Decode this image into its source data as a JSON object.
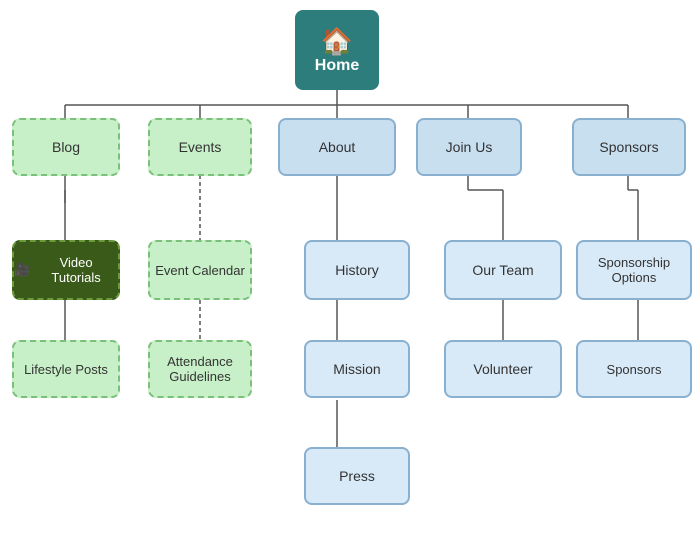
{
  "nodes": {
    "home": {
      "label": "Home",
      "icon": "🏠"
    },
    "blog": {
      "label": "Blog"
    },
    "events": {
      "label": "Events"
    },
    "about": {
      "label": "About"
    },
    "join_us": {
      "label": "Join Us"
    },
    "sponsors_top": {
      "label": "Sponsors"
    },
    "video_tutorials": {
      "label": "Video Tutorials"
    },
    "lifestyle_posts": {
      "label": "Lifestyle Posts"
    },
    "event_calendar": {
      "label": "Event Calendar"
    },
    "attendance_guidelines": {
      "label": "Attendance Guidelines"
    },
    "history": {
      "label": "History"
    },
    "mission": {
      "label": "Mission"
    },
    "press": {
      "label": "Press"
    },
    "our_team": {
      "label": "Our Team"
    },
    "volunteer": {
      "label": "Volunteer"
    },
    "sponsorship_options": {
      "label": "Sponsorship Options"
    },
    "sponsors_child": {
      "label": "Sponsors"
    }
  }
}
